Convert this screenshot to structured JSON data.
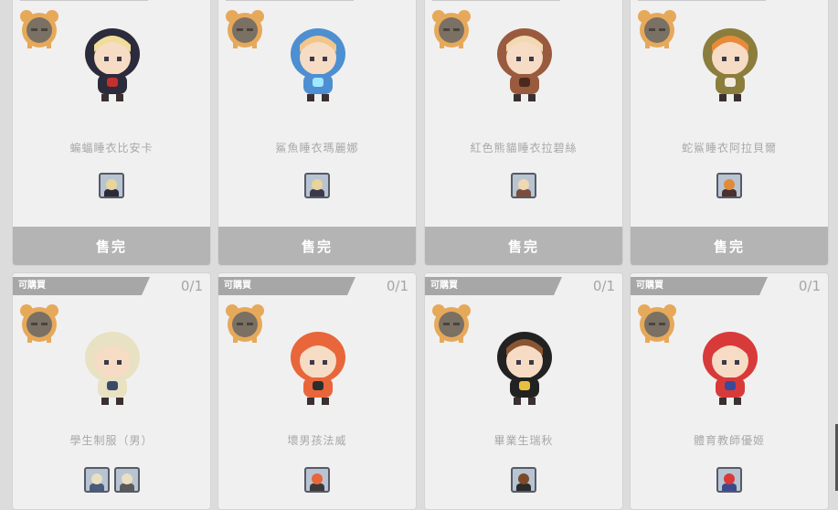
{
  "shop": {
    "sold_label": "售完",
    "buy_label": "可購買",
    "items": [
      {
        "name": "蝙蝠睡衣比安卡",
        "status": "sold",
        "chip_colors": [
          [
            "#e9d49a",
            "#2a2a3a"
          ]
        ],
        "avatar_colors": {
          "hood": "#2b2b3b",
          "hair": "#f2dc9a",
          "accent": "#c33030"
        }
      },
      {
        "name": "鯊魚睡衣瑪麗娜",
        "status": "sold",
        "chip_colors": [
          [
            "#e9d49a",
            "#3a3a4a"
          ]
        ],
        "avatar_colors": {
          "hood": "#4d8fd1",
          "hair": "#f2c68a",
          "accent": "#9fe8ff"
        }
      },
      {
        "name": "紅色熊貓睡衣拉碧絲",
        "status": "sold",
        "chip_colors": [
          [
            "#f0d8b0",
            "#7a4e3a"
          ]
        ],
        "avatar_colors": {
          "hood": "#9a5a3e",
          "hair": "#f3d9b1",
          "accent": "#4a2a1e"
        }
      },
      {
        "name": "蛇鯊睡衣阿拉貝爾",
        "status": "sold",
        "chip_colors": [
          [
            "#e08a3a",
            "#4a3030"
          ]
        ],
        "avatar_colors": {
          "hood": "#8b7d3c",
          "hair": "#e88a3a",
          "accent": "#f0ece0"
        }
      },
      {
        "name": "學生制服（男）",
        "status": "available",
        "count": "0/1",
        "chip_colors": [
          [
            "#e8e0c0",
            "#4a5a7a"
          ],
          [
            "#eadfc0",
            "#5a5a5a"
          ]
        ],
        "avatar_colors": {
          "hood": "#e8e1c2",
          "hair": "#e8e1c2",
          "accent": "#3a4a6a"
        }
      },
      {
        "name": "壞男孩法威",
        "status": "available",
        "count": "0/1",
        "chip_colors": [
          [
            "#e8663a",
            "#3a3a3a"
          ]
        ],
        "avatar_colors": {
          "hood": "#e8663a",
          "hair": "#e8663a",
          "accent": "#2d2d2d"
        }
      },
      {
        "name": "畢業生瑞秋",
        "status": "available",
        "count": "0/1",
        "chip_colors": [
          [
            "#7a4a2a",
            "#2a2a2a"
          ]
        ],
        "avatar_colors": {
          "hood": "#222222",
          "hair": "#8a5530",
          "accent": "#e8c040"
        }
      },
      {
        "name": "體育教師優姬",
        "status": "available",
        "count": "0/1",
        "chip_colors": [
          [
            "#d83a3a",
            "#3a4a8a"
          ]
        ],
        "avatar_colors": {
          "hood": "#d83a3a",
          "hair": "#d83a3a",
          "accent": "#3a4a9a"
        }
      }
    ]
  }
}
